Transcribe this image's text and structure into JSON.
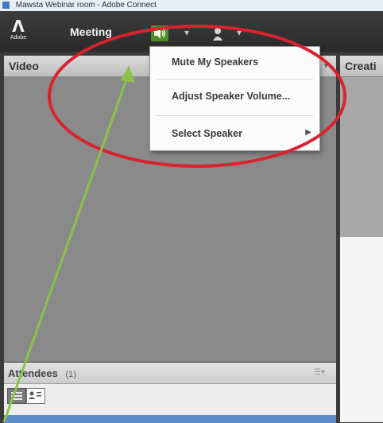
{
  "window": {
    "title": "Mawsta Webinar room - Adobe Connect"
  },
  "menubar": {
    "logo_text": "Adobe",
    "meeting_label": "Meeting"
  },
  "speaker_menu": {
    "items": [
      {
        "label": "Mute My Speakers"
      },
      {
        "label": "Adjust Speaker Volume..."
      },
      {
        "label": "Select Speaker"
      }
    ]
  },
  "pods": {
    "video_title": "Video",
    "right_title": "Creati",
    "attendees_title": "Attendees",
    "attendees_count": "(1)"
  },
  "annotation": {
    "ellipse_color": "#d9232e",
    "arrow_color": "#8bc34a"
  },
  "colors": {
    "speaker_active": "#4d8c2a",
    "selected_row": "#5e8dcb"
  }
}
